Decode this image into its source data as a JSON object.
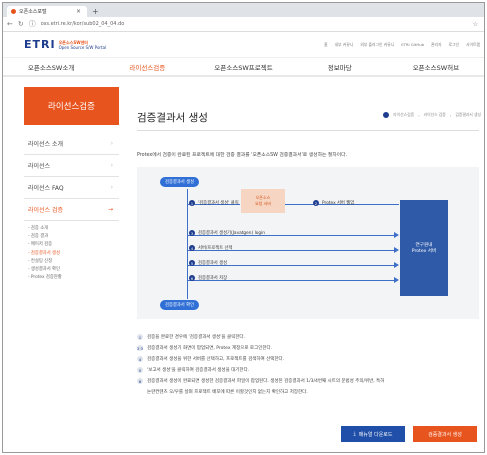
{
  "browser": {
    "tab_title": "오픈소스포털",
    "new_tab": "+",
    "url": "oss.etri.re.kr/kor/sub02_04_04.do"
  },
  "logo": {
    "text": "ETRI",
    "sub_line1": "오픈소스SW센터",
    "sub_line2": "Open Source S/W Portal"
  },
  "toplinks": [
    "홈",
    "내부 커뮤니",
    "외부 플러그인 커뮤니",
    "ETRI GitHub",
    "관리자",
    "로그인",
    "사이트맵"
  ],
  "gnb": {
    "items": [
      "오픈소스SW소개",
      "라이선스검증",
      "오픈소스SW프로젝트",
      "정보마당",
      "오픈소스SW허브"
    ]
  },
  "sidebar": {
    "title": "라이선스검증",
    "items": [
      "라이선스 소개",
      "라이선스",
      "라이선스 FAQ",
      "라이선스 검증"
    ],
    "submenu": [
      "- 검증 소개",
      "- 검증 결과",
      "- 메이저 검증",
      "- 검증결과서 생성",
      "- 컨설팅 신청",
      "- 생성결과서 확인",
      "- Protex 검증현황"
    ]
  },
  "main": {
    "title": "검증결과서 생성",
    "breadcrumb": [
      "라이선스검증",
      "라이선스 검증",
      "검증결과서 생성"
    ],
    "description": "Protex에서 검증이 완료된 프로젝트에 대한 검증 결과를 '오픈소스SW 검증결과서'로 생성하는 절차이다."
  },
  "diagram": {
    "top_pill": "검증결과서 생성",
    "bottom_pill": "검증결과서 확인",
    "report_box": "오픈소스\n요청 서버",
    "server_box": "연구원내\nProtex 서버",
    "rows": [
      {
        "num": "1",
        "text": "'검증결과서 생성' 클릭"
      },
      {
        "num": "2",
        "text": "Protex 서버 웹업"
      },
      {
        "num": "3",
        "text": "검증결과서 생성기(Javatgen) login"
      },
      {
        "num": "4",
        "text": "서버/프로젝트 선택"
      },
      {
        "num": "5",
        "text": "검증결과서 생성"
      },
      {
        "num": "6",
        "text": "검증결과서 저장"
      }
    ]
  },
  "steps": [
    {
      "num": "1",
      "text": "검증을 완료한 경우에 '검증결과서 생성'을 클릭한다."
    },
    {
      "num": "2·3",
      "text": "검증결과서 생성기 화면이 팝업되면, Protex 계정으로 로그인한다."
    },
    {
      "num": "4",
      "text": "검증결과서 생성을 위한 서버를 선택하고, 프로젝트를 검색하여 선택한다."
    },
    {
      "num": "5",
      "text": "'보고서 생성'을 클릭하여 검증결과서 생성을 대기한다."
    },
    {
      "num": "6",
      "text": "검증결과서 생성이 완료되면 생성한 검증결과서 파일이 팝업된다. 생성된 검증결과서 1/3/4번째 시트의 문법성 주의/위반, 특허"
    },
    {
      "num": "",
      "text": "논란컨텐츠 오/우를 살펴 프로젝트 배포에 따른 이할것인지 없는지 확인하고 저장한다."
    }
  ],
  "buttons": {
    "download": "매뉴얼 다운로드",
    "generate": "검증결과서 생성"
  }
}
